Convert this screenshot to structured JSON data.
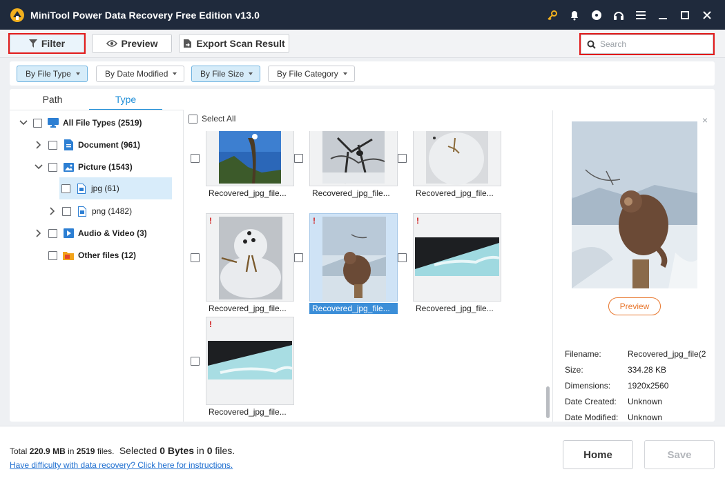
{
  "titlebar": {
    "title": "MiniTool Power Data Recovery Free Edition v13.0",
    "icons": [
      "key-icon",
      "bell-icon",
      "disc-icon",
      "headset-icon",
      "menu-icon",
      "minimize-icon",
      "maximize-icon",
      "close-icon"
    ]
  },
  "toolbar": {
    "filter_label": "Filter",
    "preview_label": "Preview",
    "export_label": "Export Scan Result",
    "search_placeholder": "Search"
  },
  "filters": {
    "items": [
      {
        "label": "By File Type",
        "active": true
      },
      {
        "label": "By Date Modified",
        "active": false
      },
      {
        "label": "By File Size",
        "active": true
      },
      {
        "label": "By File Category",
        "active": false
      }
    ]
  },
  "tabs": {
    "path": "Path",
    "type": "Type"
  },
  "tree": {
    "all": "All File Types",
    "all_count": "(2519)",
    "document": "Document",
    "document_count": "(961)",
    "picture": "Picture",
    "picture_count": "(1543)",
    "jpg": "jpg",
    "jpg_count": "(61)",
    "png": "png",
    "png_count": "(1482)",
    "audio_video": "Audio & Video",
    "audio_video_count": "(3)",
    "other": "Other files",
    "other_count": "(12)"
  },
  "grid": {
    "select_all": "Select All",
    "items": [
      {
        "label": "Recovered_jpg_file...",
        "warning": false,
        "selected": false,
        "kind": "sky-tree"
      },
      {
        "label": "Recovered_jpg_file...",
        "warning": false,
        "selected": false,
        "kind": "snow-tree"
      },
      {
        "label": "Recovered_jpg_file...",
        "warning": false,
        "selected": false,
        "kind": "snowman-top"
      },
      {
        "label": "Recovered_jpg_file...",
        "warning": true,
        "selected": false,
        "kind": "snowman"
      },
      {
        "label": "Recovered_jpg_file...",
        "warning": true,
        "selected": true,
        "kind": "monkey"
      },
      {
        "label": "Recovered_jpg_file...",
        "warning": true,
        "selected": false,
        "kind": "sky-strip"
      },
      {
        "label": "Recovered_jpg_file...",
        "warning": true,
        "selected": false,
        "kind": "sky-strip"
      }
    ],
    "warning_mark": "!"
  },
  "preview": {
    "button_label": "Preview",
    "close_mark": "×",
    "meta": [
      {
        "key": "Filename:",
        "value": "Recovered_jpg_file(2"
      },
      {
        "key": "Size:",
        "value": "334.28 KB"
      },
      {
        "key": "Dimensions:",
        "value": "1920x2560"
      },
      {
        "key": "Date Created:",
        "value": "Unknown"
      },
      {
        "key": "Date Modified:",
        "value": "Unknown"
      }
    ]
  },
  "footer": {
    "total_prefix": "Total",
    "total_size": "220.9 MB",
    "total_in": "in",
    "total_files": "2519",
    "total_files_suffix": "files.",
    "selected_prefix": "Selected",
    "selected_size": "0 Bytes",
    "selected_in": "in",
    "selected_files": "0",
    "selected_suffix": "files.",
    "help_link": "Have difficulty with data recovery? Click here for instructions.",
    "home_label": "Home",
    "save_label": "Save"
  },
  "colors": {
    "titlebar_bg": "#1f2a3c",
    "accent_blue": "#1f8fd8",
    "highlight_red": "#e21a1a",
    "preview_orange": "#e8762c"
  }
}
